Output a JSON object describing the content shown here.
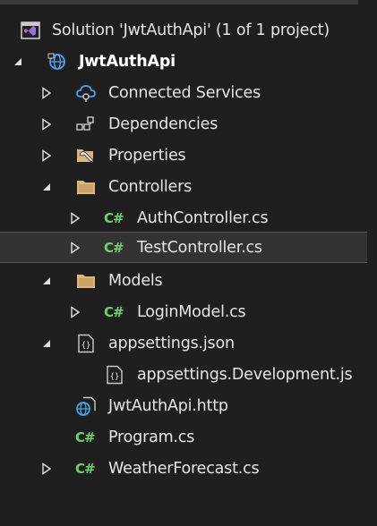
{
  "solution": {
    "label": "Solution 'JwtAuthApi' (1 of 1 project)",
    "icon": "visual-studio-solution-icon"
  },
  "project": {
    "label": "JwtAuthApi",
    "icon": "web-project-globe-icon"
  },
  "items": {
    "connected_services": {
      "label": "Connected Services",
      "icon": "connected-services-cloud-icon"
    },
    "dependencies": {
      "label": "Dependencies",
      "icon": "dependencies-icon"
    },
    "properties": {
      "label": "Properties",
      "icon": "wrench-properties-icon"
    },
    "controllers": {
      "label": "Controllers",
      "icon": "folder-icon"
    },
    "auth_controller": {
      "label": "AuthController.cs",
      "icon": "csharp-file-icon",
      "badge": "C#"
    },
    "test_controller": {
      "label": "TestController.cs",
      "icon": "csharp-file-icon",
      "badge": "C#",
      "selected": true
    },
    "models": {
      "label": "Models",
      "icon": "folder-icon"
    },
    "login_model": {
      "label": "LoginModel.cs",
      "icon": "csharp-file-icon",
      "badge": "C#"
    },
    "appsettings": {
      "label": "appsettings.json",
      "icon": "json-file-icon"
    },
    "appsettings_dev": {
      "label": "appsettings.Development.js",
      "icon": "json-file-icon"
    },
    "http_file": {
      "label": "JwtAuthApi.http",
      "icon": "http-file-icon"
    },
    "program": {
      "label": "Program.cs",
      "icon": "csharp-file-icon",
      "badge": "C#"
    },
    "weather": {
      "label": "WeatherForecast.cs",
      "icon": "csharp-file-icon",
      "badge": "C#"
    }
  },
  "colors": {
    "background": "#1f1f1f",
    "selected_row": "#333333",
    "csharp_green": "#6fd16f",
    "folder_tan": "#dcb67a",
    "text": "#e6e6e6"
  }
}
